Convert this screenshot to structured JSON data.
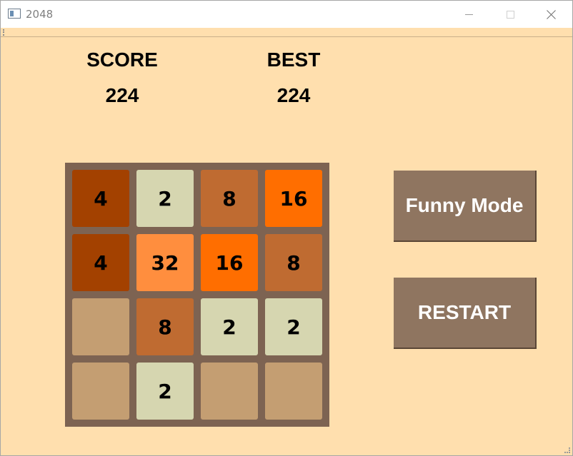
{
  "window": {
    "title": "2048"
  },
  "score": {
    "label": "SCORE",
    "value": "224"
  },
  "best": {
    "label": "BEST",
    "value": "224"
  },
  "board": {
    "rows": [
      [
        {
          "value": "4",
          "color": "#a34100"
        },
        {
          "value": "2",
          "color": "#d6d6b0"
        },
        {
          "value": "8",
          "color": "#bf6b31"
        },
        {
          "value": "16",
          "color": "#ff6e00"
        }
      ],
      [
        {
          "value": "4",
          "color": "#a34100"
        },
        {
          "value": "32",
          "color": "#ff8e3e"
        },
        {
          "value": "16",
          "color": "#ff6e00"
        },
        {
          "value": "8",
          "color": "#bf6b31"
        }
      ],
      [
        {
          "value": "",
          "color": "#c49e72"
        },
        {
          "value": "8",
          "color": "#bf6b31"
        },
        {
          "value": "2",
          "color": "#d6d6b0"
        },
        {
          "value": "2",
          "color": "#d6d6b0"
        }
      ],
      [
        {
          "value": "",
          "color": "#c49e72"
        },
        {
          "value": "2",
          "color": "#d6d6b0"
        },
        {
          "value": "",
          "color": "#c49e72"
        },
        {
          "value": "",
          "color": "#c49e72"
        }
      ]
    ]
  },
  "buttons": {
    "funny_mode": "Funny Mode",
    "restart": "RESTART"
  },
  "colors": {
    "background": "#ffdfae",
    "board": "#7d6352",
    "button": "#8f7560"
  },
  "icons": {
    "app": "app-window-icon",
    "minimize": "minimize-icon",
    "maximize": "maximize-icon",
    "close": "close-icon"
  }
}
